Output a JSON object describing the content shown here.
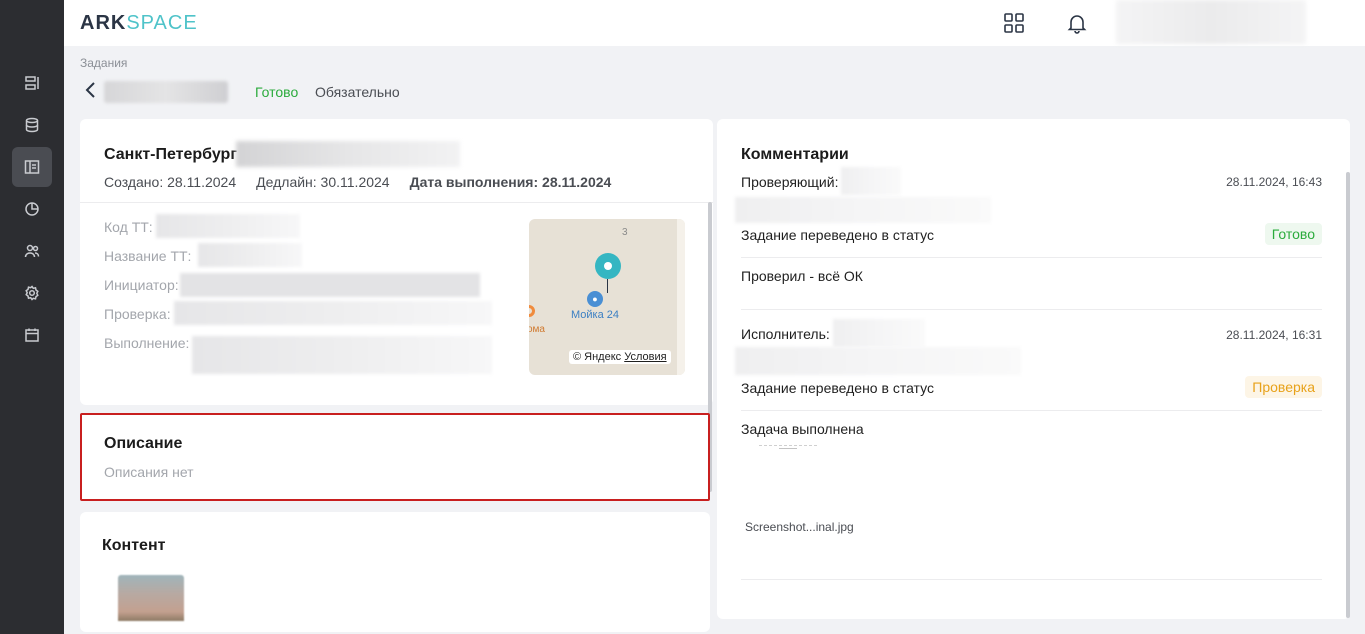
{
  "app": {
    "logo_main": "ARK",
    "logo_accent": "SPACE"
  },
  "breadcrumb": "Задания",
  "task": {
    "status": "Готово",
    "required": "Обязательно",
    "city": "Санкт-Петербург",
    "created": "Создано: 28.11.2024",
    "deadline": "Дедлайн: 30.11.2024",
    "completed": "Дата выполнения: 28.11.2024",
    "fields": {
      "code": "Код ТТ:",
      "name": "Название ТТ:",
      "initiator": "Инициатор:",
      "check": "Проверка:",
      "execution": "Выполнение:"
    }
  },
  "map": {
    "house_number": "3",
    "poi_label": "Мойка 24",
    "poi_partial": "ома",
    "copyright": "© Яндекс",
    "terms": "Условия"
  },
  "description": {
    "title": "Описание",
    "empty": "Описания нет"
  },
  "content": {
    "title": "Контент"
  },
  "comments": {
    "title": "Комментарии",
    "items": [
      {
        "role": "Проверяющий:",
        "date": "28.11.2024, 16:43",
        "status_text": "Задание переведено в статус",
        "status": "Готово",
        "message": "Проверил - всё ОК"
      },
      {
        "role": "Исполнитель:",
        "date": "28.11.2024, 16:31",
        "status_text": "Задание переведено в статус",
        "status": "Проверка",
        "message": "Задача выполнена",
        "attachment": "Screenshot...inal.jpg"
      }
    ]
  },
  "colors": {
    "sidebar_bg": "#2c2d31",
    "accent_teal": "#4fc3c9",
    "status_green": "#2bab3c",
    "status_orange": "#e8a21a",
    "highlight_red": "#c81f1f"
  },
  "icons": {
    "sidebar": [
      "list-icon",
      "database-icon",
      "tasks-icon",
      "chart-pie-icon",
      "users-icon",
      "settings-icon",
      "calendar-icon"
    ],
    "header": [
      "apps-grid-icon",
      "bell-icon"
    ]
  }
}
